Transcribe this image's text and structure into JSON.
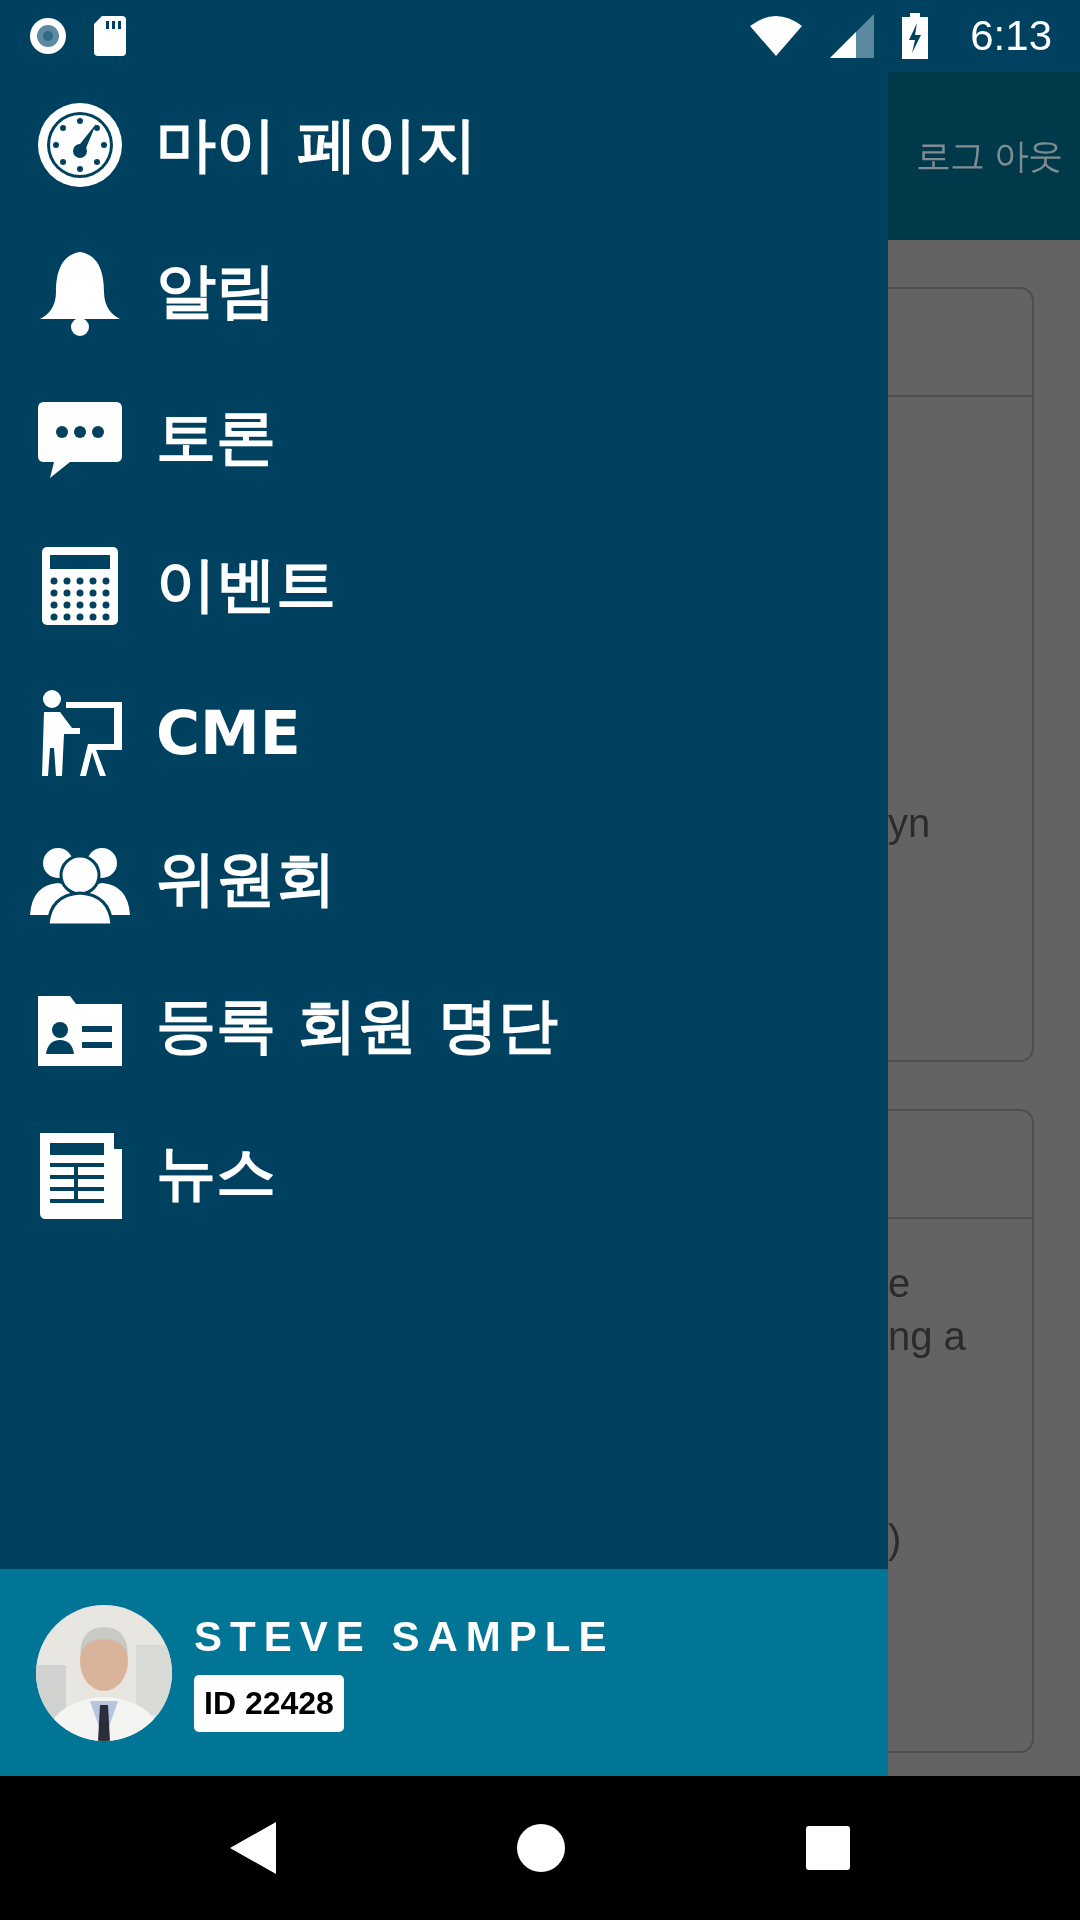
{
  "status_bar": {
    "time": "6:13"
  },
  "background": {
    "header_action": "로그 아웃",
    "cards": [
      {
        "paragraphs": [
          [
            "yn"
          ]
        ]
      },
      {
        "paragraphs": [
          [
            "e",
            "ng a"
          ],
          [
            ")"
          ]
        ]
      }
    ]
  },
  "drawer": {
    "menu_items": [
      {
        "label": "마이 페이지"
      },
      {
        "label": "알림"
      },
      {
        "label": "토론"
      },
      {
        "label": "이벤트"
      },
      {
        "label": "CME"
      },
      {
        "label": "위원회"
      },
      {
        "label": "등록 회원 명단"
      },
      {
        "label": "뉴스"
      }
    ],
    "profile": {
      "name": "STEVE SAMPLE",
      "id": "ID 22428"
    }
  }
}
